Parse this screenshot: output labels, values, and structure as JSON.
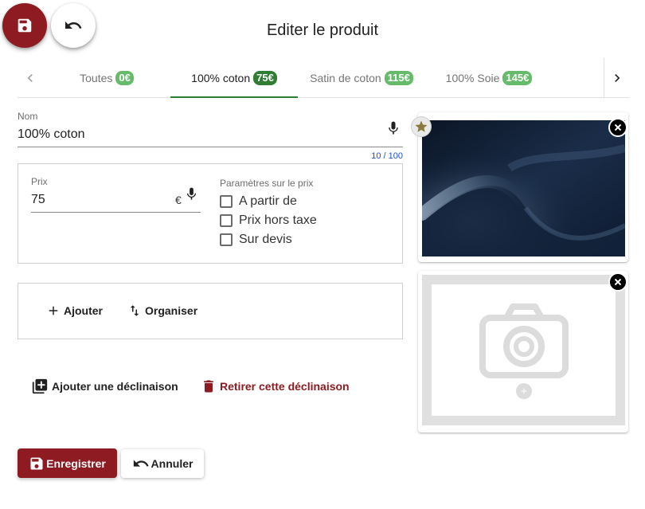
{
  "header": {
    "title": "Editer le produit",
    "fab_save_icon": "floppy-disk-icon",
    "fab_undo_icon": "undo-icon"
  },
  "tabs": [
    {
      "label": "Toutes",
      "badge": "0€",
      "active": false
    },
    {
      "label": "100% coton",
      "badge": "75€",
      "active": true
    },
    {
      "label": "Satin de coton",
      "badge": "115€",
      "active": false
    },
    {
      "label": "100% Soie",
      "badge": "145€",
      "active": false
    }
  ],
  "name_field": {
    "label": "Nom",
    "value": "100% coton",
    "counter": "10 / 100",
    "icon": "microphone-icon"
  },
  "price_box": {
    "label": "Prix",
    "value": "75",
    "currency": "€",
    "settings_title": "Paramètres sur le prix",
    "options": [
      {
        "label": "A partir de",
        "checked": false
      },
      {
        "label": "Prix hors taxe",
        "checked": false
      },
      {
        "label": "Sur devis",
        "checked": false
      }
    ]
  },
  "list_box": {
    "add_label": "Ajouter",
    "organize_label": "Organiser"
  },
  "variants": {
    "add_label": "Ajouter une déclinaison",
    "remove_label": "Retirer cette déclinaison"
  },
  "actions": {
    "save_label": "Enregistrer",
    "cancel_label": "Annuler"
  },
  "colors": {
    "primary": "#8e1b22",
    "active_tab": "#2e7d32",
    "badge": "#66bb6a",
    "counter": "#1a4fd0"
  }
}
